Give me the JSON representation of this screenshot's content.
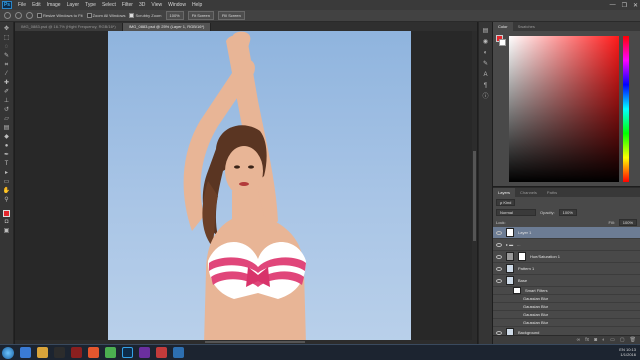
{
  "app": {
    "logo": "Ps"
  },
  "menu": [
    "File",
    "Edit",
    "Image",
    "Layer",
    "Type",
    "Select",
    "Filter",
    "3D",
    "View",
    "Window",
    "Help"
  ],
  "window_controls": [
    "—",
    "❐",
    "✕"
  ],
  "options": {
    "resize_windows": "Resize Windows to Fit",
    "zoom_all": "Zoom All Windows",
    "scrubby_zoom": "Scrubby Zoom",
    "btn_100": "100%",
    "fit_screen": "Fit Screen",
    "fill_screen": "Fill Screen"
  },
  "doc_tabs": [
    "IMG_0883.psd @ 16.7% (Hight Frequency, RGB/16*)",
    "IMG_0883.psd @ 25% (Layer 1, RGB/16*)"
  ],
  "color_panel": {
    "tabs": [
      "Color",
      "Swatches"
    ],
    "fg": "#e3262c",
    "bg": "#ffffff"
  },
  "layers_panel": {
    "tabs": [
      "Layers",
      "Channels",
      "Paths"
    ],
    "kind": "ρ Kind",
    "blend": "Normal",
    "opacity_label": "Opacity:",
    "opacity_value": "100%",
    "lock_label": "Lock:",
    "fill_label": "Fill:",
    "fill_value": "100%",
    "layers": [
      {
        "name": "Layer 1",
        "type": "white"
      },
      {
        "name": "...",
        "type": "folder"
      },
      {
        "name": "Hue/Saturation 1",
        "type": "adj"
      },
      {
        "name": "Pattern 1",
        "type": "img"
      },
      {
        "name": "Base",
        "type": "img"
      }
    ],
    "smart_filters": "Smart Filters",
    "filters": [
      "Gaussian Blur",
      "Gaussian Blur",
      "Gaussian Blur",
      "Gaussian Blur"
    ],
    "background": "Background"
  },
  "taskbar": {
    "lang": "EN",
    "time": "10:13",
    "date": "1/1/2016"
  }
}
